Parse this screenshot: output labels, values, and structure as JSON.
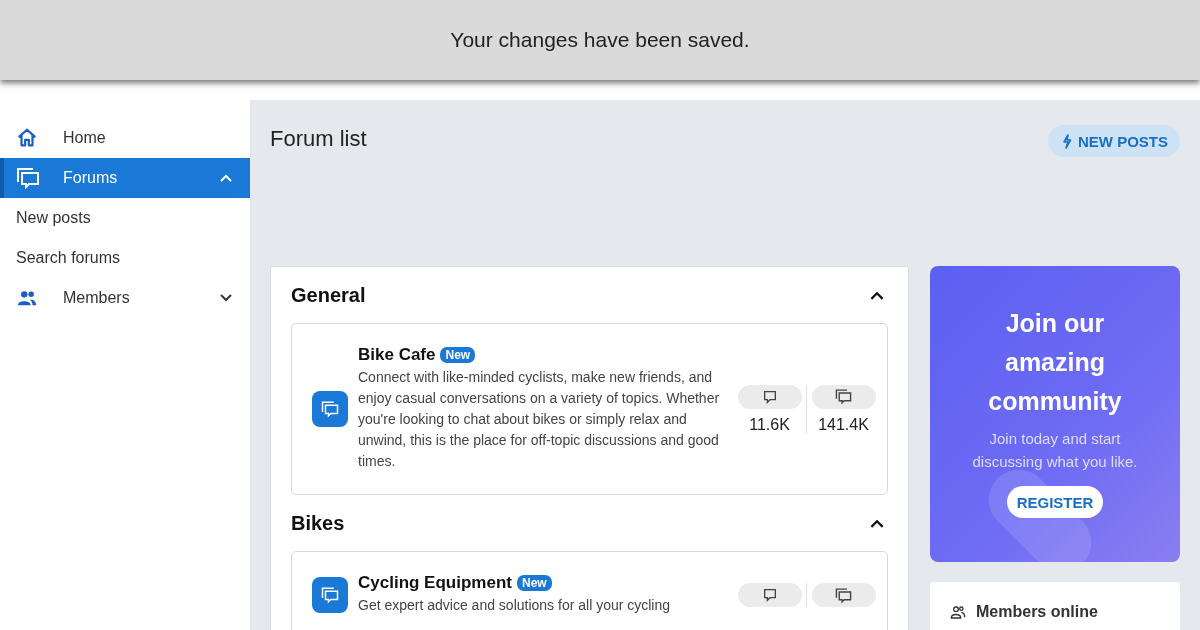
{
  "toast": {
    "message": "Your changes have been saved."
  },
  "sidebar": {
    "items": [
      {
        "label": "Home",
        "kind": "home",
        "selected": false
      },
      {
        "label": "Forums",
        "kind": "forums",
        "selected": true,
        "expanded": true
      },
      {
        "label": "New posts",
        "kind": "subitem",
        "selected": false
      },
      {
        "label": "Search forums",
        "kind": "subitem",
        "selected": false
      },
      {
        "label": "Members",
        "kind": "members",
        "selected": false,
        "expanded": false
      }
    ]
  },
  "page": {
    "title": "Forum list",
    "new_posts_button": "NEW POSTS"
  },
  "categories": [
    {
      "title": "General",
      "expanded": true,
      "forums": [
        {
          "title": "Bike Cafe",
          "badge": "New",
          "description": "Connect with like-minded cyclists, make new friends, and enjoy casual conversations on a variety of topics. Whether you're looking to chat about bikes or simply relax and unwind, this is the place for off-topic discussions and good times.",
          "threads": "11.6K",
          "messages": "141.4K"
        }
      ]
    },
    {
      "title": "Bikes",
      "expanded": true,
      "forums": [
        {
          "title": "Cycling Equipment",
          "badge": "New",
          "description": "Get expert advice and solutions for all your cycling"
        }
      ]
    }
  ],
  "join_card": {
    "title": "Join our amazing community",
    "text": "Join today and start discussing what you like.",
    "button": "REGISTER"
  },
  "members_online": {
    "title": "Members online"
  }
}
